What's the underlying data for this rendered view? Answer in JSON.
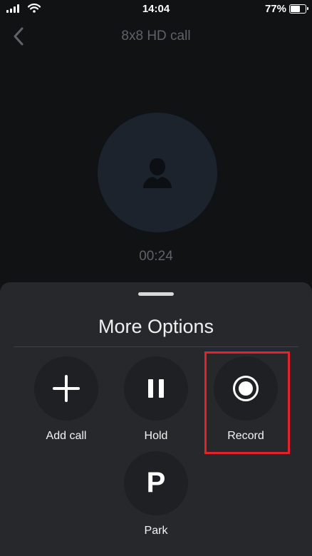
{
  "status_bar": {
    "time": "14:04",
    "battery": "77%",
    "battery_level": 0.77
  },
  "header": {
    "title": "8x8 HD call",
    "back_icon": "chevron-left-icon"
  },
  "call": {
    "avatar_icon": "person-silhouette-icon",
    "duration": "00:24"
  },
  "options_sheet": {
    "title": "More Options",
    "options": [
      {
        "label": "Add call",
        "icon": "plus-icon"
      },
      {
        "label": "Hold",
        "icon": "pause-icon"
      },
      {
        "label": "Record",
        "icon": "record-icon"
      },
      {
        "label": "Park",
        "icon": "park-icon",
        "glyph": "P"
      }
    ]
  },
  "colors": {
    "background": "#111214",
    "sheet": "#27282c",
    "option_circle": "#1f2023",
    "avatar": "#1c232c",
    "highlight": "#e2222e"
  }
}
